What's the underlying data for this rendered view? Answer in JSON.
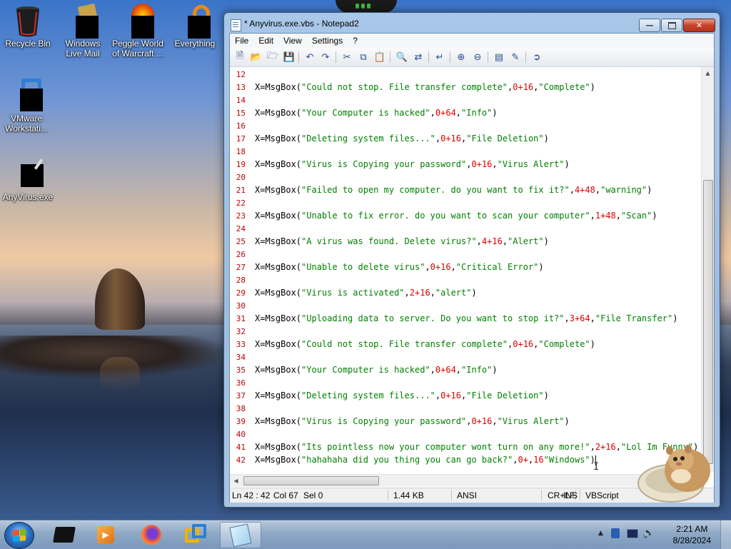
{
  "desktop": {
    "icons": [
      {
        "label": "Recycle Bin"
      },
      {
        "label": "Windows Live Mail"
      },
      {
        "label": "Peggle World of Warcraft ..."
      },
      {
        "label": "Everything"
      },
      {
        "label": "VMware Workstati..."
      },
      {
        "label": "AnyVirus.exe"
      }
    ]
  },
  "window": {
    "title": "* Anyvirus.exe.vbs - Notepad2",
    "menu": [
      "File",
      "Edit",
      "View",
      "Settings",
      "?"
    ]
  },
  "editor": {
    "lines": [
      {
        "n": "12",
        "code": ""
      },
      {
        "n": "13",
        "code": "X=MsgBox(\"Could not stop. File transfer complete\",0+16,\"Complete\")"
      },
      {
        "n": "14",
        "code": ""
      },
      {
        "n": "15",
        "code": "X=MsgBox(\"Your Computer is hacked\",0+64,\"Info\")"
      },
      {
        "n": "16",
        "code": ""
      },
      {
        "n": "17",
        "code": "X=MsgBox(\"Deleting system files...\",0+16,\"File Deletion\")"
      },
      {
        "n": "18",
        "code": ""
      },
      {
        "n": "19",
        "code": "X=MsgBox(\"Virus is Copying your password\",0+16,\"Virus Alert\")"
      },
      {
        "n": "20",
        "code": ""
      },
      {
        "n": "21",
        "code": "X=MsgBox(\"Failed to open my computer. do you want to fix it?\",4+48,\"warning\")"
      },
      {
        "n": "22",
        "code": ""
      },
      {
        "n": "23",
        "code": "X=MsgBox(\"Unable to fix error. do you want to scan your computer\",1+48,\"Scan\")"
      },
      {
        "n": "24",
        "code": ""
      },
      {
        "n": "25",
        "code": "X=MsgBox(\"A virus was found. Delete virus?\",4+16,\"Alert\")"
      },
      {
        "n": "26",
        "code": ""
      },
      {
        "n": "27",
        "code": "X=MsgBox(\"Unable to delete virus\",0+16,\"Critical Error\")"
      },
      {
        "n": "28",
        "code": ""
      },
      {
        "n": "29",
        "code": "X=MsgBox(\"Virus is activated\",2+16,\"alert\")"
      },
      {
        "n": "30",
        "code": ""
      },
      {
        "n": "31",
        "code": "X=MsgBox(\"Uploading data to server. Do you want to stop it?\",3+64,\"File Transfer\")"
      },
      {
        "n": "32",
        "code": ""
      },
      {
        "n": "33",
        "code": "X=MsgBox(\"Could not stop. File transfer complete\",0+16,\"Complete\")"
      },
      {
        "n": "34",
        "code": ""
      },
      {
        "n": "35",
        "code": "X=MsgBox(\"Your Computer is hacked\",0+64,\"Info\")"
      },
      {
        "n": "36",
        "code": ""
      },
      {
        "n": "37",
        "code": "X=MsgBox(\"Deleting system files...\",0+16,\"File Deletion\")"
      },
      {
        "n": "38",
        "code": ""
      },
      {
        "n": "39",
        "code": "X=MsgBox(\"Virus is Copying your password\",0+16,\"Virus Alert\")"
      },
      {
        "n": "40",
        "code": ""
      },
      {
        "n": "41",
        "code": "X=MsgBox(\"Its pointless now your computer wont turn on any more!\",2+16,\"Lol Im Funny\")"
      },
      {
        "n": "42",
        "code": "X=MsgBox(\"hahahaha did you thing you can go back?\",0+,16\"Windows\")"
      }
    ]
  },
  "status": {
    "position": "Ln 42 : 42",
    "column": "Col 67",
    "selection": "Sel 0",
    "size": "1.44 KB",
    "encoding": "ANSI",
    "line_endings": "CR+LF",
    "mode": "INS",
    "lexer": "VBScript"
  },
  "taskbar": {
    "clock_time": "2:21 AM",
    "clock_date": "8/28/2024"
  },
  "colors": {
    "string": "#008000",
    "number": "#e00000",
    "line_number": "#c00000"
  }
}
